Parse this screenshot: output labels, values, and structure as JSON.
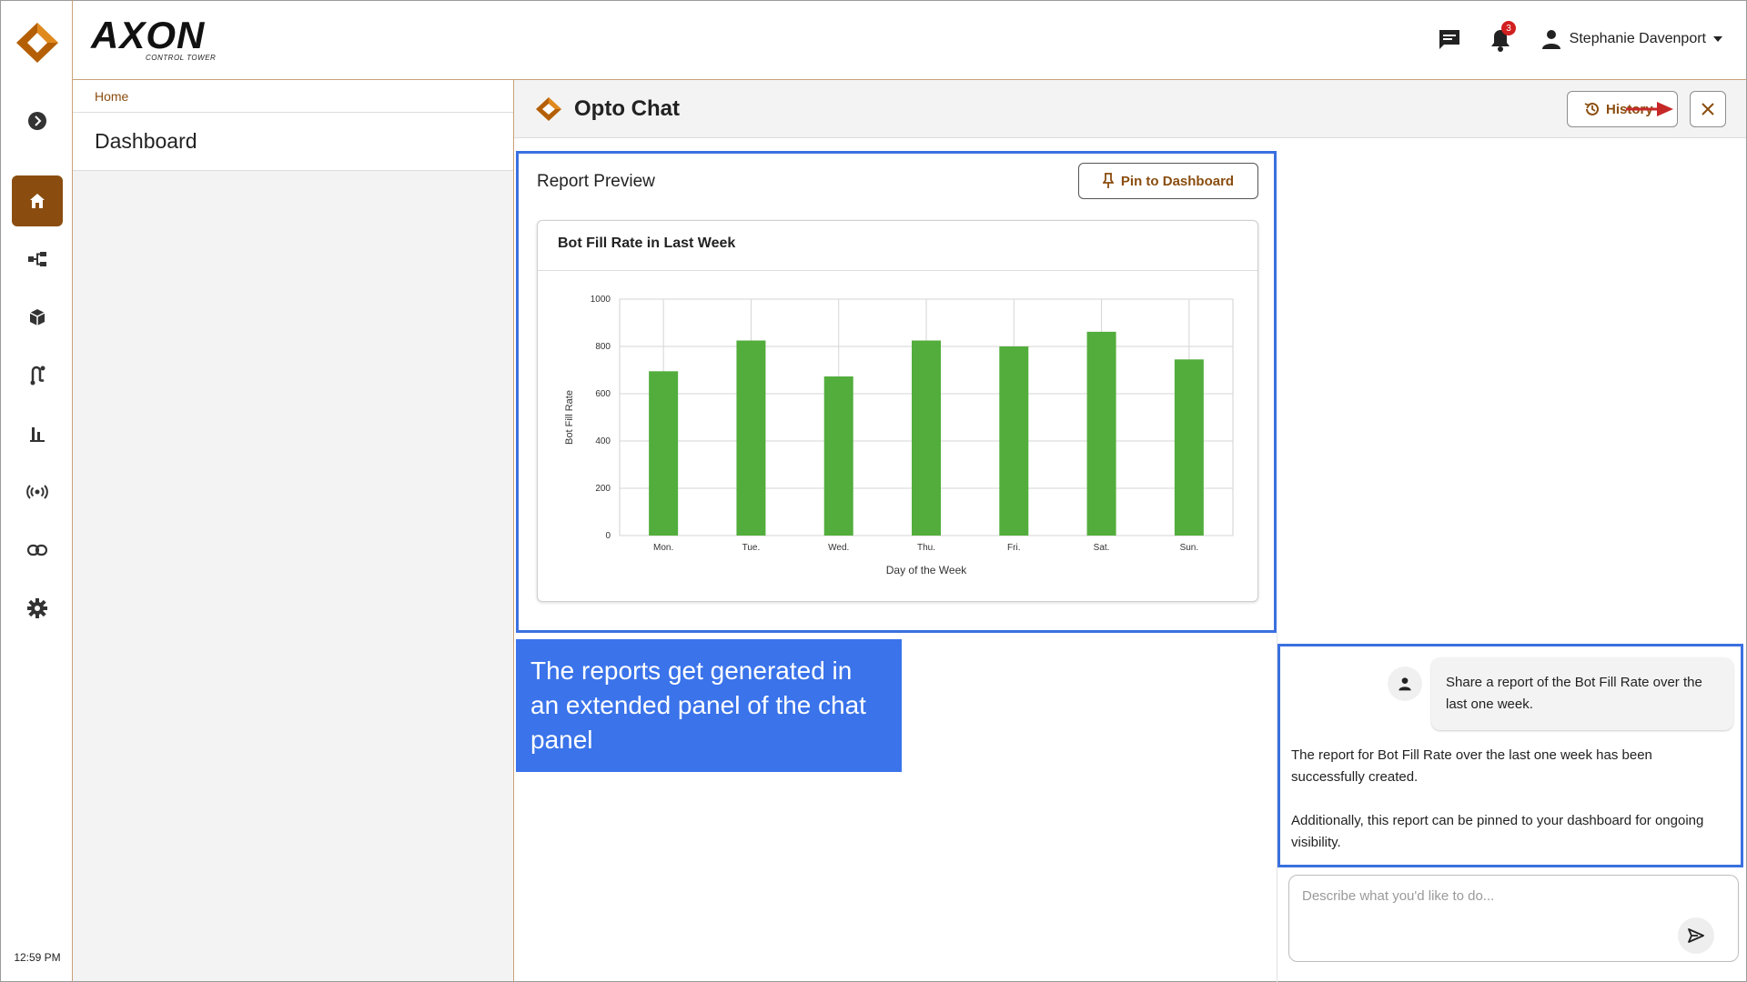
{
  "app": {
    "brand_word": "AXON",
    "brand_sub": "CONTROL TOWER",
    "time": "12:59 PM"
  },
  "topbar": {
    "notification_count": "3",
    "user_name": "Stephanie Davenport"
  },
  "dashboard": {
    "breadcrumb": "Home",
    "title": "Dashboard"
  },
  "chat": {
    "title": "Opto Chat",
    "history_label": "History",
    "report": {
      "title": "Report Preview",
      "pin_label": "Pin to Dashboard"
    },
    "callout_text": "The reports get generated in an extended panel of the chat panel",
    "user_message": "Share a report of the Bot Fill Rate over the last one week.",
    "bot_message_1": "The report for Bot Fill Rate over the last one week has been successfully created.",
    "bot_message_2": "Additionally, this report can be pinned to your dashboard for ongoing visibility.",
    "input_placeholder": "Describe what you'd like to do..."
  },
  "colors": {
    "brand": "#8a4d0f",
    "accent_orange": "#b45f06",
    "bar": "#52ad3c",
    "annotation_blue": "#3a70e0"
  },
  "chart_data": {
    "type": "bar",
    "title": "Bot Fill Rate in Last Week",
    "xlabel": "Day of the Week",
    "ylabel": "Bot Fill Rate",
    "categories": [
      "Mon.",
      "Tue.",
      "Wed.",
      "Thu.",
      "Fri.",
      "Sat.",
      "Sun."
    ],
    "values": [
      695,
      825,
      673,
      825,
      800,
      862,
      745
    ],
    "ylim": [
      0,
      1000
    ],
    "yticks": [
      0,
      200,
      400,
      600,
      800,
      1000
    ],
    "grid": true
  }
}
